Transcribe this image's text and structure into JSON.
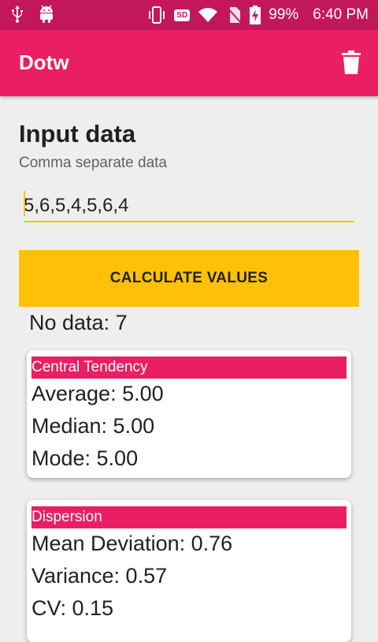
{
  "status_bar": {
    "battery": "99%",
    "time": "6:40 PM",
    "sd_label": "SD"
  },
  "app_bar": {
    "title": "Dotw"
  },
  "input_section": {
    "heading": "Input data",
    "subheading": "Comma separate data",
    "value": "5,6,5,4,5,6,4"
  },
  "calculate_button": {
    "label": "CALCULATE VALUES"
  },
  "no_data": "No data: 7",
  "central_tendency": {
    "title": "Central Tendency",
    "average": "Average: 5.00",
    "median": "Median: 5.00",
    "mode": "Mode: 5.00"
  },
  "dispersion": {
    "title": "Dispersion",
    "mean_deviation": "Mean Deviation: 0.76",
    "variance": "Variance: 0.57",
    "cv": "CV: 0.15"
  },
  "colors": {
    "status_bar": "#c2185b",
    "app_bar": "#e91e63",
    "accent": "#ffc107"
  }
}
